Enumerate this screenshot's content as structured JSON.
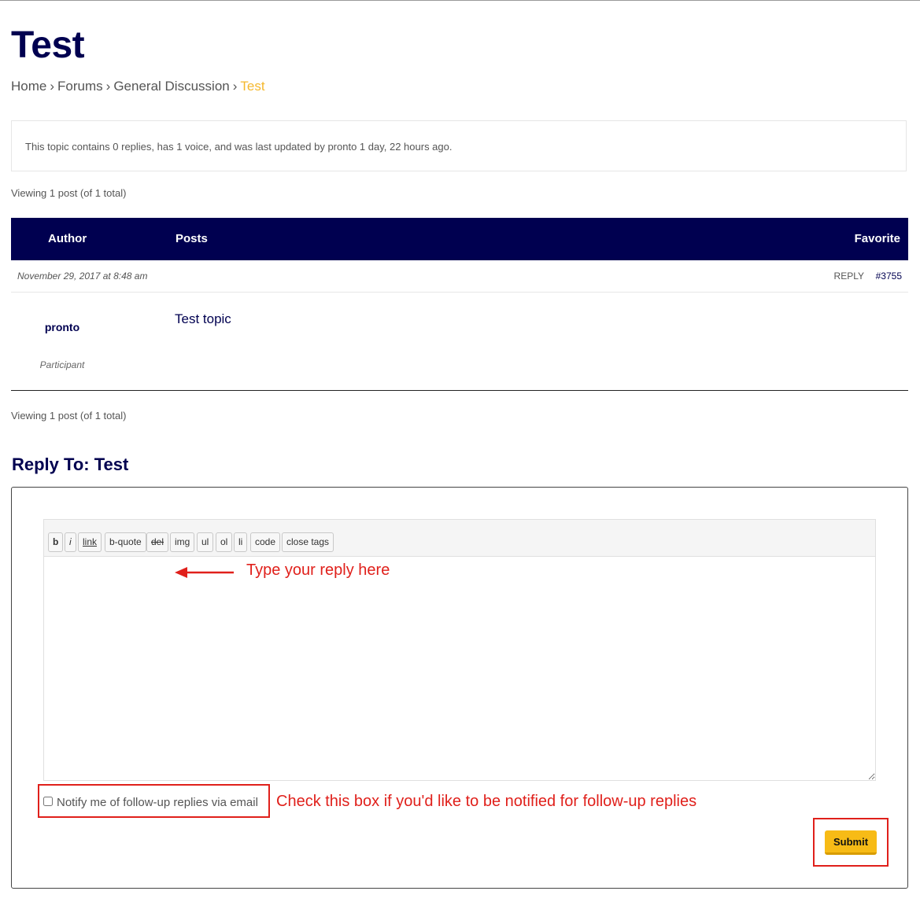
{
  "page": {
    "title": "Test"
  },
  "breadcrumb": {
    "items": [
      "Home",
      "Forums",
      "General Discussion"
    ],
    "separator": "›",
    "current": "Test"
  },
  "topic_notice": "This topic contains 0 replies, has 1 voice, and was last updated by  pronto 1 day, 22 hours ago.",
  "viewing_top": "Viewing 1 post (of 1 total)",
  "viewing_bottom": "Viewing 1 post (of 1 total)",
  "table_header": {
    "author": "Author",
    "posts": "Posts",
    "favorite": "Favorite"
  },
  "post": {
    "date": "November 29, 2017 at 8:48 am",
    "reply_label": "REPLY",
    "permalink": "#3755",
    "author": "pronto",
    "role": "Participant",
    "content": "Test topic"
  },
  "reply_form": {
    "heading": "Reply To: Test",
    "toolbar": [
      "b",
      "i",
      "link",
      "b-quote",
      "del",
      "img",
      "ul",
      "ol",
      "li",
      "code",
      "close tags"
    ],
    "textarea_value": "",
    "notify_label": "Notify me of follow-up replies via email",
    "notify_checked": false,
    "submit_label": "Submit"
  },
  "annotations": {
    "reply_hint": "Type your reply here",
    "notify_hint": "Check this box if you'd like to be notified for follow-up replies"
  },
  "colors": {
    "brand_navy": "#000050",
    "accent_yellow": "#f7bb16",
    "annotation_red": "#e0201b",
    "breadcrumb_current": "#f5b82e"
  }
}
